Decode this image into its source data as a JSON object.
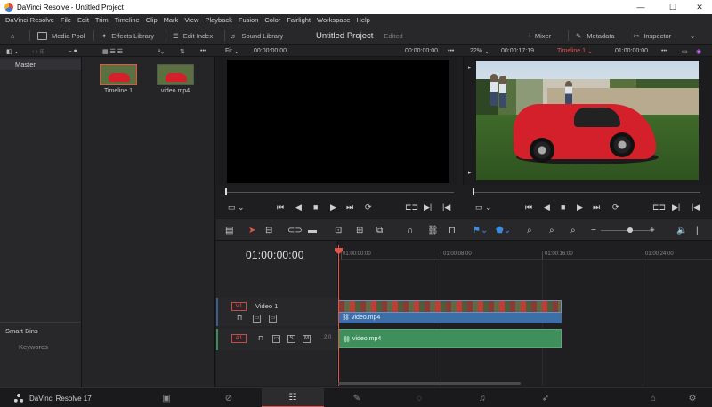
{
  "window": {
    "title": "DaVinci Resolve - Untitled Project",
    "controls": {
      "minimize": "—",
      "maximize": "☐",
      "close": "✕"
    }
  },
  "menu": [
    "DaVinci Resolve",
    "File",
    "Edit",
    "Trim",
    "Timeline",
    "Clip",
    "Mark",
    "View",
    "Playback",
    "Fusion",
    "Color",
    "Fairlight",
    "Workspace",
    "Help"
  ],
  "toolbar": {
    "media_pool": "Media Pool",
    "effects_library": "Effects Library",
    "edit_index": "Edit Index",
    "sound_library": "Sound Library",
    "project_title": "Untitled Project",
    "project_status": "Edited",
    "mixer": "Mixer",
    "metadata": "Metadata",
    "inspector": "Inspector"
  },
  "source_viewer": {
    "fit": "Fit",
    "timecode_left": "00:00:00:00",
    "timecode_right": "00:00:00:00"
  },
  "program_viewer": {
    "zoom": "22%",
    "duration": "00:00:17:19",
    "timeline_name": "Timeline 1",
    "timecode": "01:00:00:00"
  },
  "bins": {
    "master": "Master",
    "smart_bins": "Smart Bins",
    "keywords": "Keywords"
  },
  "media_pool": {
    "clips": [
      {
        "label": "Timeline 1"
      },
      {
        "label": "video.mp4"
      }
    ]
  },
  "timeline": {
    "timecode": "01:00:00:00",
    "ruler": [
      "01:00:00:00",
      "01:00:08:00",
      "01:00:16:00",
      "01:00:24:00"
    ],
    "video_track": {
      "badge": "V1",
      "name": "Video 1",
      "clip": "video.mp4"
    },
    "audio_track": {
      "badge": "A1",
      "solo": "S",
      "mute": "M",
      "channels": "2.0",
      "clip": "video.mp4"
    }
  },
  "pagebar": {
    "brand": "DaVinci Resolve 17",
    "active_page": "edit"
  }
}
